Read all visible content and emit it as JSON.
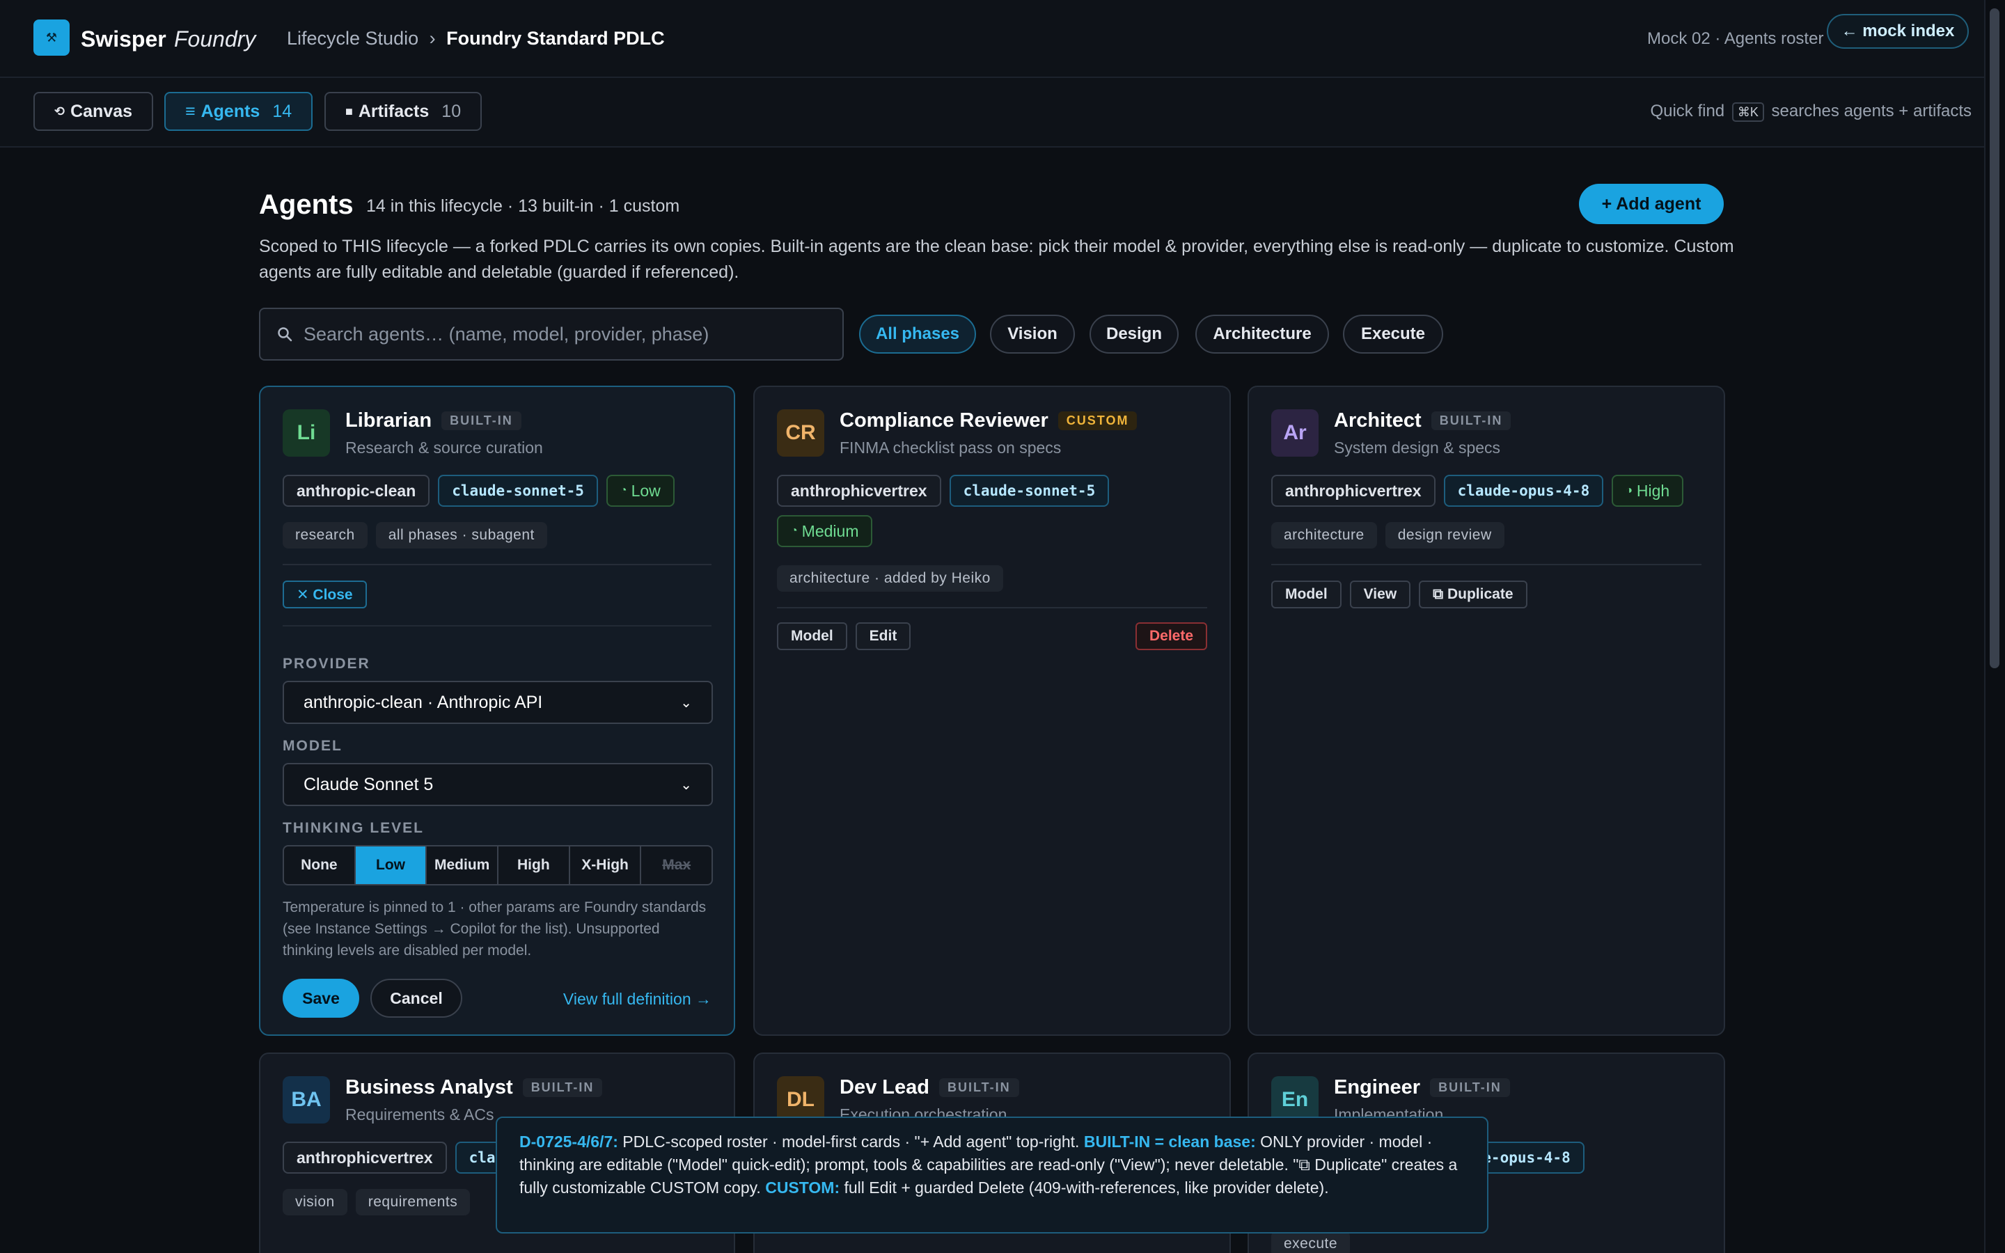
{
  "topbar": {
    "logo_glyph": "⚒",
    "brand": "Swisper",
    "brand_sub": "Foundry",
    "breadcrumb": {
      "parent": "Lifecycle Studio",
      "sep": "›",
      "current": "Foundry Standard PDLC"
    },
    "mock_label": "Mock 02 · Agents roster",
    "mock_index": "← mock index"
  },
  "tabs": [
    {
      "icon": "⟲",
      "label": "Canvas",
      "count": ""
    },
    {
      "icon": "≡",
      "label": "Agents",
      "count": "14"
    },
    {
      "icon": "■",
      "label": "Artifacts",
      "count": "10"
    }
  ],
  "quickfind": {
    "pre": "Quick find",
    "key": "⌘K",
    "post": "searches agents + artifacts"
  },
  "header": {
    "title": "Agents",
    "meta": "14 in this lifecycle · 13 built-in · 1 custom",
    "add_button": "+ Add agent",
    "description": "Scoped to THIS lifecycle — a forked PDLC carries its own copies. Built-in agents are the clean base: pick their model & provider, everything else is read-only — duplicate to customize. Custom agents are fully editable and deletable (guarded if referenced)."
  },
  "search": {
    "placeholder": "Search agents… (name, model, provider, phase)",
    "value": ""
  },
  "filters": [
    "All phases",
    "Vision",
    "Design",
    "Architecture",
    "Execute"
  ],
  "cards": {
    "librarian": {
      "initials": "Li",
      "name": "Librarian",
      "badge": "BUILT-IN",
      "sub": "Research & source curation",
      "provider": "anthropic-clean",
      "model": "claude-sonnet-5",
      "level": "Low",
      "tags": [
        "research",
        "all phases · subagent"
      ],
      "close": "✕ Close",
      "provider_label": "PROVIDER",
      "provider_value": "anthropic-clean · Anthropic API",
      "model_label": "MODEL",
      "model_value": "Claude Sonnet 5",
      "thinking_label": "THINKING LEVEL",
      "levels": [
        "None",
        "Low",
        "Medium",
        "High",
        "X-High",
        "Max"
      ],
      "note": "Temperature is pinned to 1 · other params are Foundry standards (see Instance Settings → Copilot for the list). Unsupported thinking levels are disabled per model.",
      "save": "Save",
      "cancel": "Cancel",
      "view_def": "View full definition →"
    },
    "compliance": {
      "initials": "CR",
      "name": "Compliance Reviewer",
      "badge": "CUSTOM",
      "sub": "FINMA checklist pass on specs",
      "provider": "anthrophicvertrex",
      "model": "claude-sonnet-5",
      "level": "Medium",
      "tags": [
        "architecture · added by Heiko"
      ],
      "btn_model": "Model",
      "btn_edit": "Edit",
      "btn_delete": "Delete"
    },
    "architect": {
      "initials": "Ar",
      "name": "Architect",
      "badge": "BUILT-IN",
      "sub": "System design & specs",
      "provider": "anthrophicvertrex",
      "model": "claude-opus-4-8",
      "level": "High",
      "tags": [
        "architecture",
        "design review"
      ],
      "btn_model": "Model",
      "btn_view": "View",
      "btn_dup": "⧉ Duplicate"
    },
    "ba": {
      "initials": "BA",
      "name": "Business Analyst",
      "badge": "BUILT-IN",
      "sub": "Requirements & ACs",
      "provider": "anthrophicvertrex",
      "model": "cla",
      "tags": [
        "vision",
        "requirements"
      ]
    },
    "devlead": {
      "initials": "DL",
      "name": "Dev Lead",
      "badge": "BUILT-IN",
      "sub": "Execution orchestration"
    },
    "engineer": {
      "initials": "En",
      "name": "Engineer",
      "badge": "BUILT-IN",
      "sub": "Implementation",
      "model": "ude-opus-4-8",
      "tags": [
        "execute"
      ]
    }
  },
  "footnote": {
    "id": "D-0725-4/6/7:",
    "t1": " PDLC-scoped roster · model-first cards · \"+ Add agent\" top-right. ",
    "hl1": "BUILT-IN = clean base:",
    "t2": " ONLY provider · model · thinking are editable (\"Model\" quick-edit); prompt, tools & capabilities are read-only (\"View\"); never deletable. \"⧉ Duplicate\" creates a fully customizable CUSTOM copy. ",
    "hl2": "CUSTOM:",
    "t3": " full Edit + guarded Delete (409-with-references, like provider delete)."
  }
}
